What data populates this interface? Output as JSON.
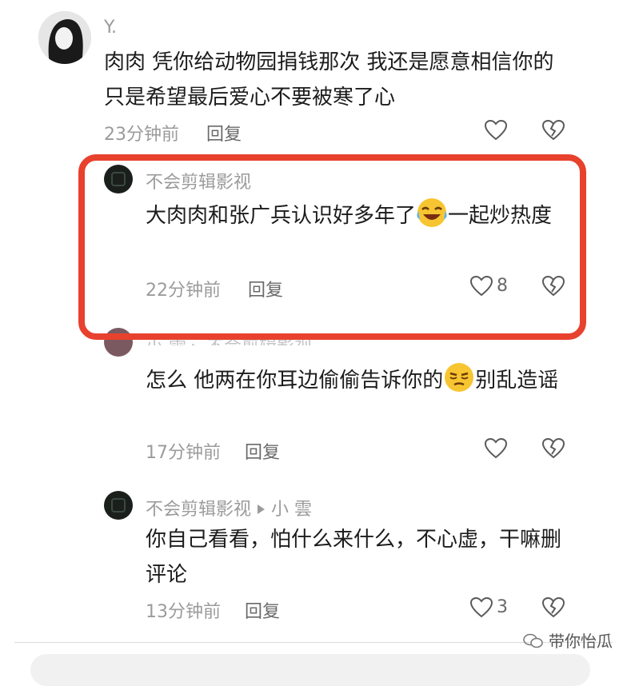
{
  "comments": [
    {
      "author": "Y.",
      "text": "肉肉 凭你给动物园捐钱那次 我还是愿意相信你的 只是希望最后爱心不要被寒了心",
      "time": "23分钟前",
      "reply": "回复",
      "likes": ""
    },
    {
      "author": "不会剪辑影视",
      "text_a": "大肉肉和张广兵认识好多年了",
      "text_b": "一起炒热度",
      "time": "22分钟前",
      "reply": "回复",
      "likes": "8"
    },
    {
      "author": "小 雲 ▸ 不会剪辑影视",
      "text_a": "怎么 他两在你耳边偷偷告诉你的",
      "text_b": "别乱造谣",
      "time": "17分钟前",
      "reply": "回复",
      "likes": ""
    },
    {
      "author": "不会剪辑影视",
      "reply_to": "小 雲",
      "text": "你自己看看，怕什么来什么，不心虚，干嘛删评论",
      "time": "13分钟前",
      "reply": "回复",
      "likes": "3"
    }
  ],
  "watermark": "带你怡瓜",
  "icons": {
    "like": "heart-outline-icon",
    "dislike": "broken-heart-icon",
    "laugh": "laugh-cry-emoji",
    "sneer": "smirk-emoji"
  }
}
